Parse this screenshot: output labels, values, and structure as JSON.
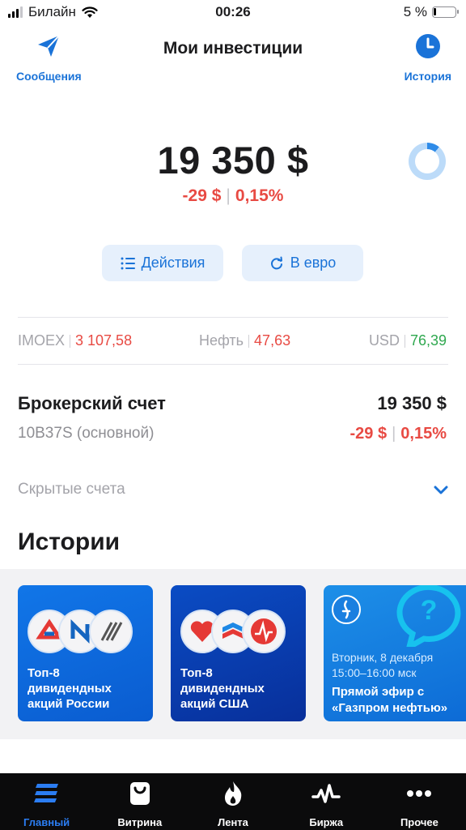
{
  "status_bar": {
    "carrier": "Билайн",
    "time": "00:26",
    "battery": "5 %"
  },
  "header": {
    "title": "Мои инвестиции",
    "left_button": {
      "label": "Сообщения",
      "icon": "paper-plane-icon"
    },
    "right_button": {
      "label": "История",
      "icon": "clock-icon"
    }
  },
  "portfolio": {
    "total": "19 350 $",
    "change_abs": "-29 $",
    "change_pct": "0,15%"
  },
  "buttons": {
    "actions": "Действия",
    "currency": "В евро"
  },
  "tickers": [
    {
      "name": "IMOEX",
      "value": "3 107,58",
      "trend": "negative"
    },
    {
      "name": "Нефть",
      "value": "47,63",
      "trend": "negative"
    },
    {
      "name": "USD",
      "value": "76,39",
      "trend": "positive"
    }
  ],
  "account": {
    "title": "Брокерский счет",
    "subtitle": "10B37S (основной)",
    "total": "19 350 $",
    "change_abs": "-29 $",
    "change_pct": "0,15%"
  },
  "hidden_accounts": "Скрытые счета",
  "stories": {
    "title": "Истории",
    "items": [
      {
        "text": "Топ-8\nдивидендных\nакций России"
      },
      {
        "text": "Топ-8\nдивидендных\nакций США"
      },
      {
        "date": "Вторник, 8 декабря\n15:00–16:00 мск",
        "headline": "Прямой эфир с\n«Газпром нефтью»"
      }
    ]
  },
  "tabs": [
    {
      "label": "Главный",
      "icon": "home-stack-icon",
      "active": true
    },
    {
      "label": "Витрина",
      "icon": "shopping-bag-icon",
      "active": false
    },
    {
      "label": "Лента",
      "icon": "flame-icon",
      "active": false
    },
    {
      "label": "Биржа",
      "icon": "pulse-icon",
      "active": false
    },
    {
      "label": "Прочее",
      "icon": "more-dots-icon",
      "active": false
    }
  ],
  "colors": {
    "accent": "#1a73d8",
    "negative": "#e84a43",
    "positive": "#2fa84f",
    "tabbar": "#0b0b0c"
  }
}
